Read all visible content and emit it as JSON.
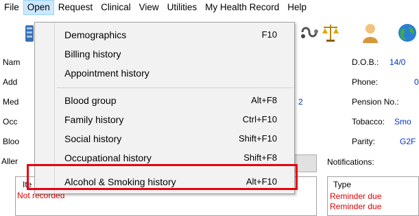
{
  "menubar": {
    "items": [
      "File",
      "Open",
      "Request",
      "Clinical",
      "View",
      "Utilities",
      "My Health Record",
      "Help"
    ]
  },
  "dropdown": {
    "items": [
      {
        "label": "Demographics",
        "shortcut": "F10"
      },
      {
        "label": "Billing history",
        "shortcut": ""
      },
      {
        "label": "Appointment history",
        "shortcut": ""
      },
      {
        "label": "Blood group",
        "shortcut": "Alt+F8"
      },
      {
        "label": "Family history",
        "shortcut": "Ctrl+F10"
      },
      {
        "label": "Social history",
        "shortcut": "Shift+F10"
      },
      {
        "label": "Occupational history",
        "shortcut": "Shift+F8"
      },
      {
        "label": "Alcohol & Smoking history",
        "shortcut": "Alt+F10"
      }
    ]
  },
  "form": {
    "left_labels": [
      "Nam",
      "Add",
      "Med",
      "Occ",
      "Bloo",
      "Aller"
    ],
    "med_value_fragment": "2",
    "right_labels": {
      "dob": "D.O.B.:",
      "phone": "Phone:",
      "pension": "Pension No.:",
      "tobacco": "Tobacco:",
      "parity": "Parity:"
    },
    "right_values": {
      "dob": "14/0",
      "phone": "0",
      "tobacco": "Smo",
      "parity": "G2F"
    },
    "notifications_label": "Notifications:"
  },
  "left_panel": {
    "header_fragment": "Ite",
    "row": "Not recorded"
  },
  "notifications_panel": {
    "header": "Type",
    "rows": [
      "Reminder due",
      "Reminder due"
    ]
  },
  "colors": {
    "menu_active_bg": "#cce8ff",
    "highlight_border": "#e8000b",
    "value_blue": "#0033cc",
    "alert_red": "#e00000"
  },
  "icons": [
    "database-icon",
    "stethoscope-icon",
    "scales-icon",
    "person-icon",
    "globe-icon"
  ]
}
